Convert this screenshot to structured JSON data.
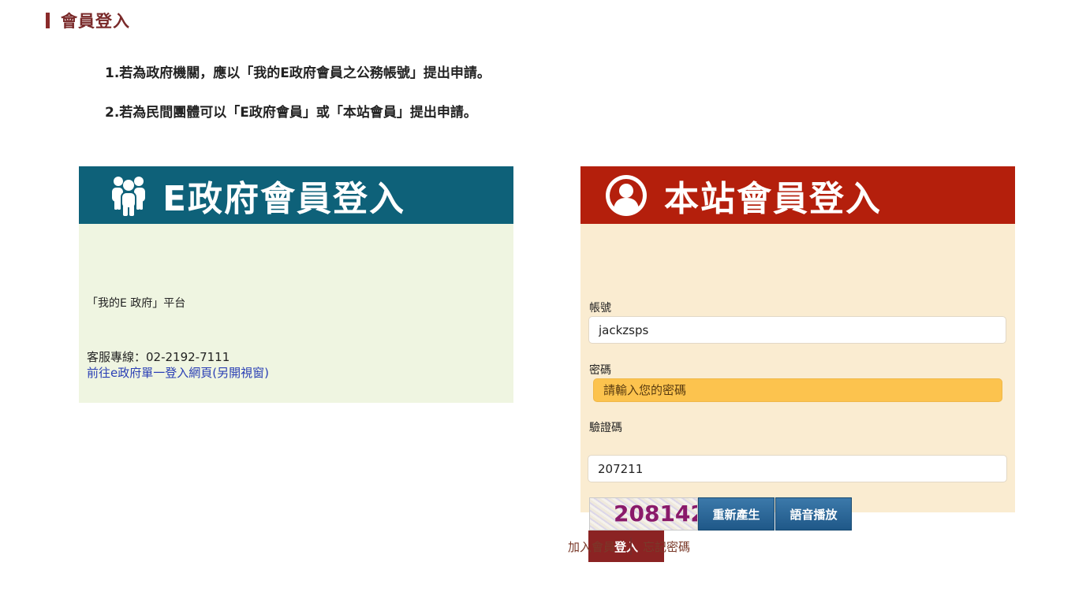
{
  "page": {
    "title": "會員登入"
  },
  "notes": [
    "1.若為政府機關，應以「我的E政府會員之公務帳號」提出申請。",
    "2.若為民間團體可以「E政府會員」或「本站會員」提出申請。"
  ],
  "egov": {
    "header": "E政府會員登入",
    "platform": "「我的E 政府」平台",
    "hotline": "客服專線：02-2192-7111",
    "link": "前往e政府單一登入網頁(另開視窗)"
  },
  "site": {
    "header": "本站會員登入",
    "account_label": "帳號",
    "account_value": "jackzsps",
    "password_label": "密碼",
    "password_placeholder": "請輸入您的密碼",
    "captcha_label": "驗證碼",
    "captcha_value": "207211",
    "captcha_image_text": "208142",
    "regenerate_label": "重新產生",
    "audio_label": "語音播放",
    "login_label": "登入"
  },
  "footer": {
    "join_label": "加入會員",
    "forgot_label": "忘記密碼"
  },
  "colors": {
    "egov_header": "#0e6179",
    "egov_body": "#eff5e1",
    "site_header": "#b41f0c",
    "site_body": "#faecd1",
    "password_highlight": "#fcc34e",
    "login_button": "#8b2323",
    "title_color": "#7a2a2a"
  },
  "icons": {
    "egov": "people-group-icon",
    "site": "user-circle-icon"
  }
}
